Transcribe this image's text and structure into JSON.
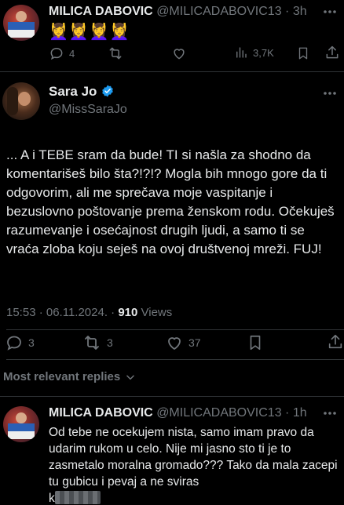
{
  "top_tweet": {
    "author_name": "MILICA DABOVIC",
    "author_handle": "@MILICADABOVIC13",
    "time": "· 3h",
    "text": "💆‍♀️💆‍♀️💆‍♀️💆‍♀️",
    "actions": {
      "replies": "4",
      "retweets": "",
      "likes": "",
      "views": "3,7K"
    }
  },
  "main_tweet": {
    "author_name": "Sara Jo",
    "author_handle": "@MissSaraJo",
    "verified": true,
    "text": "... A i TEBE sram da bude! TI si našla za shodno da komentarišeš bilo šta?!?!? Mogla bih mnogo gore da ti odgovorim, ali me sprečava moje vaspitanje i bezuslovno poštovanje prema ženskom rodu. Očekuješ razumevanje i osećajnost drugih ljudi, a samo ti se vraća zloba koju seješ na ovoj društvenoj mreži. FUJ!",
    "timestamp": "15:53 · 06.11.2024. · ",
    "views_count": "910",
    "views_label": " Views",
    "actions": {
      "replies": "3",
      "retweets": "3",
      "likes": "37"
    }
  },
  "replies_filter": {
    "label": "Most relevant replies"
  },
  "reply_tweet": {
    "author_name": "MILICA DABOVIC",
    "author_handle": "@MILICADABOVIC13",
    "time": "· 1h",
    "text": "Od tebe ne ocekujem nista, samo imam pravo da udarim rukom u celo. Nije mi jasno sto ti je to zasmetalo moralna gromado??? Tako da mala zacepi tu gubicu i pevaj a ne sviras",
    "text_tail": "k"
  },
  "colors": {
    "background": "#000000",
    "text": "#e7e9ea",
    "muted": "#71767b",
    "divider": "#2f3336",
    "verified": "#1d9bf0"
  }
}
